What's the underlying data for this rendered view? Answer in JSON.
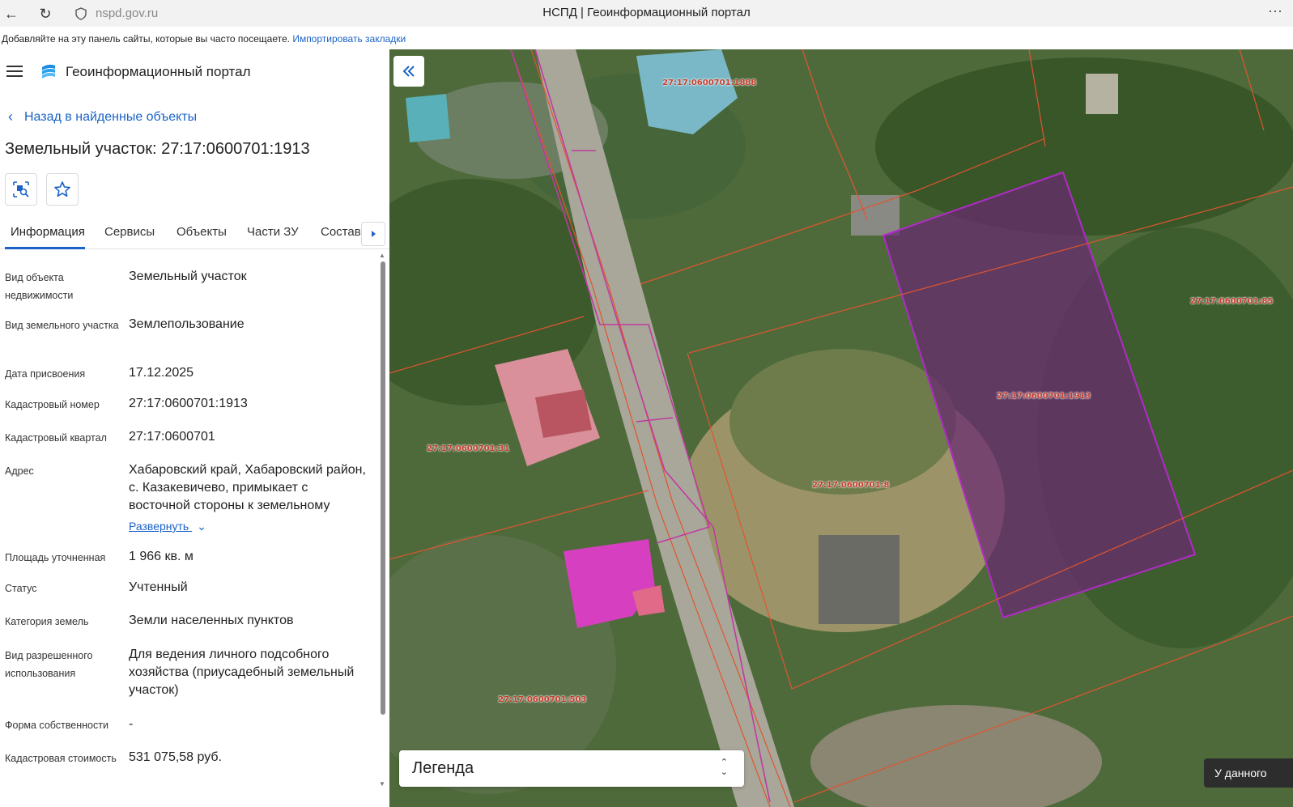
{
  "browser": {
    "url": "nspd.gov.ru",
    "title": "НСПД | Геоинформационный портал",
    "bookmarks_text": "Добавляйте на эту панель сайты, которые вы часто посещаете.",
    "bookmarks_link": "Импортировать закладки"
  },
  "header": {
    "portal_name": "Геоинформационный портал"
  },
  "panel": {
    "back_label": "Назад в найденные объекты",
    "title": "Земельный участок: 27:17:0600701:1913",
    "tabs": [
      "Информация",
      "Сервисы",
      "Объекты",
      "Части ЗУ",
      "Состав"
    ],
    "expand_label": "Развернуть",
    "properties": [
      {
        "label": "Вид объекта недвижимости",
        "value": "Земельный участок"
      },
      {
        "label": "Вид земельного участка",
        "value": "Землепользование"
      },
      {
        "label": "Дата присвоения",
        "value": "17.12.2025"
      },
      {
        "label": "Кадастровый номер",
        "value": "27:17:0600701:1913"
      },
      {
        "label": "Кадастровый квартал",
        "value": "27:17:0600701"
      },
      {
        "label": "Адрес",
        "value": "Хабаровский край, Хабаровский район, с. Казакевичево, примыкает с восточной стороны к земельному"
      },
      {
        "label": "Площадь уточненная",
        "value": "1 966 кв. м"
      },
      {
        "label": "Статус",
        "value": "Учтенный"
      },
      {
        "label": "Категория земель",
        "value": "Земли населенных пунктов"
      },
      {
        "label": "Вид разрешенного использования",
        "value": "Для ведения личного подсобного хозяйства (приусадебный земельный участок)"
      },
      {
        "label": "Форма собственности",
        "value": "-"
      },
      {
        "label": "Кадастровая стоимость",
        "value": "531 075,58 руб."
      }
    ]
  },
  "map": {
    "labels": [
      "27:17:0600701:1888",
      "27:17:0600701:85",
      "27:17:0600701:1913",
      "27:17:0600701:31",
      "27:17:0600701:8",
      "27:17:0600701:503"
    ],
    "legend_label": "Легенда",
    "note_button": "У данного"
  },
  "colors": {
    "accent": "#1a62c7",
    "parcel_border": "#e0552f",
    "selected_parcel": "#a020c0"
  }
}
